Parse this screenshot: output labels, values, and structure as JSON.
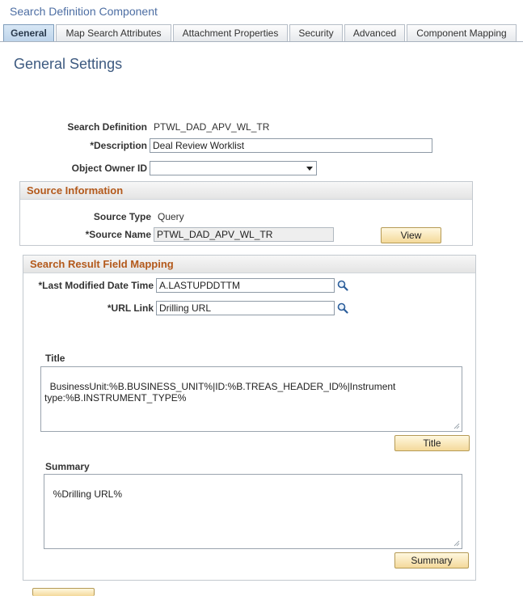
{
  "component": {
    "title": "Search Definition Component"
  },
  "tabs": [
    {
      "label": "General",
      "active": true
    },
    {
      "label": "Map Search Attributes"
    },
    {
      "label": "Attachment Properties"
    },
    {
      "label": "Security"
    },
    {
      "label": "Advanced"
    },
    {
      "label": "Component Mapping"
    }
  ],
  "page": {
    "heading": "General Settings"
  },
  "general": {
    "search_definition_label": "Search Definition",
    "search_definition_value": "PTWL_DAD_APV_WL_TR",
    "description_label": "*Description",
    "description_value": "Deal Review Worklist",
    "owner_label": "Object Owner ID",
    "owner_value": ""
  },
  "source": {
    "header": "Source Information",
    "type_label": "Source Type",
    "type_value": "Query",
    "name_label": "*Source Name",
    "name_value": "PTWL_DAD_APV_WL_TR",
    "view_button": "View"
  },
  "mapping": {
    "header": "Search Result Field Mapping",
    "last_modified_label": "*Last Modified Date Time",
    "last_modified_value": "A.LASTUPDDTTM",
    "url_link_label": "*URL Link",
    "url_link_value": "Drilling URL",
    "title_label": "Title",
    "title_value": "BusinessUnit:%B.BUSINESS_UNIT%|ID:%B.TREAS_HEADER_ID%|Instrument type:%B.INSTRUMENT_TYPE%",
    "title_button": "Title",
    "summary_label": "Summary",
    "summary_value": "%Drilling URL%",
    "summary_button": "Summary"
  },
  "colors": {
    "accent_blue": "#4d6ea3",
    "group_header_text": "#b3591b",
    "button_fill": "#f4d99a"
  }
}
